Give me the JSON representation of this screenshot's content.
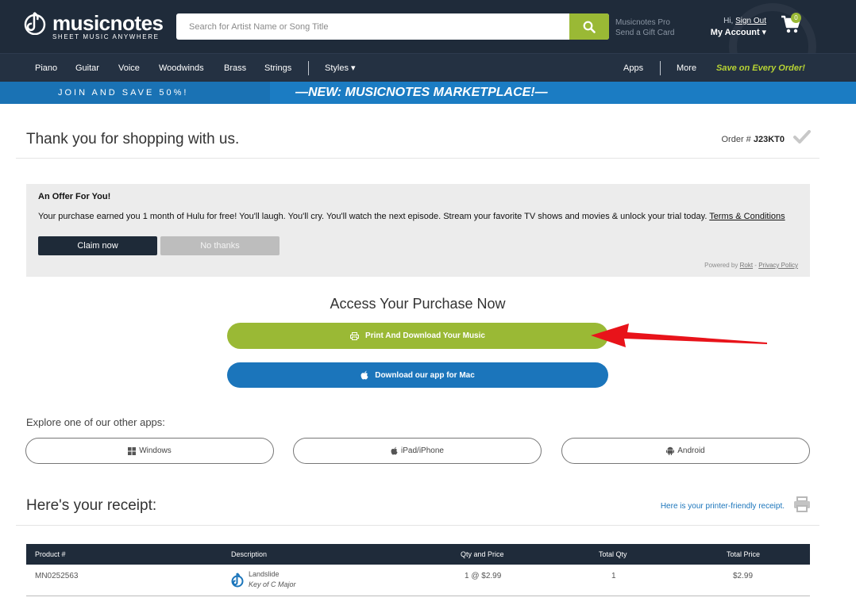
{
  "header": {
    "logo_text": "musicnotes",
    "logo_subtitle": "SHEET MUSIC ANYWHERE",
    "search_placeholder": "Search for Artist Name or Song Title",
    "pro_link": "Musicnotes Pro",
    "gift_link": "Send a Gift Card",
    "greeting": "Hi,",
    "sign_out": "Sign Out",
    "my_account": "My Account",
    "cart_count": "0"
  },
  "nav": {
    "items": [
      "Piano",
      "Guitar",
      "Voice",
      "Woodwinds",
      "Brass",
      "Strings"
    ],
    "styles": "Styles",
    "apps": "Apps",
    "more": "More",
    "save": "Save on Every Order!"
  },
  "promo": {
    "join": "JOIN AND SAVE 50%!",
    "marketplace": "—NEW: MUSICNOTES MARKETPLACE!—"
  },
  "page": {
    "thanks": "Thank you for shopping with us.",
    "order_label": "Order #",
    "order_number": "J23KT0"
  },
  "offer": {
    "title": "An Offer For You!",
    "text": "Your purchase earned you 1 month of Hulu for free! You'll laugh. You'll cry. You'll watch the next episode. Stream your favorite TV shows and movies & unlock your trial today.",
    "terms": "Terms & Conditions",
    "claim": "Claim now",
    "decline": "No thanks",
    "powered_by": "Powered by",
    "rokt": "Rokt",
    "dash": "-",
    "privacy": "Privacy Policy"
  },
  "access": {
    "title": "Access Your Purchase Now",
    "print_button": "Print And Download Your Music",
    "mac_button": "Download our app for Mac"
  },
  "apps": {
    "label": "Explore one of our other apps:",
    "windows": "Windows",
    "ipad": "iPad/iPhone",
    "android": "Android"
  },
  "receipt": {
    "title": "Here's your receipt:",
    "printer_link": "Here is your printer-friendly receipt.",
    "columns": [
      "Product #",
      "Description",
      "Qty and Price",
      "Total Qty",
      "Total Price"
    ],
    "rows": [
      {
        "product": "MN0252563",
        "title": "Landslide",
        "key": "Key of C Major",
        "qty_price": "1 @ $2.99",
        "total_qty": "1",
        "total_price": "$2.99"
      }
    ]
  },
  "colors": {
    "header_bg": "#1f2b3a",
    "green": "#9ab935",
    "blue": "#1b75bb",
    "arrow": "#e8131a"
  }
}
